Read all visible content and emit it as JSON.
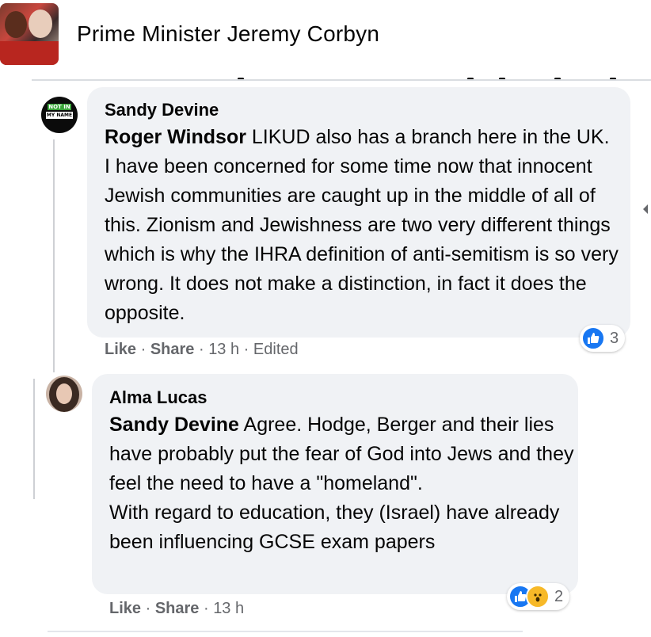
{
  "header": {
    "group_name": "Prime Minister Jeremy Corbyn"
  },
  "comments": [
    {
      "author": "Sandy Devine",
      "avatar_text": [
        "NOT IN",
        "MY NAME"
      ],
      "mention": "Roger Windsor",
      "text": " LIKUD also has a branch here in the UK. I have been concerned for some time now that innocent Jewish communities are caught up in the middle of all of this. Zionism and Jewishness are two very different things which is why the IHRA definition of anti-semitism is so very wrong. It does not make a distinction, in fact it does the opposite.",
      "actions": {
        "like": "Like",
        "share": "Share",
        "sep": " · ",
        "time": "13 h",
        "edited": "Edited"
      },
      "reactions": {
        "icons": [
          "like-icon"
        ],
        "count": "3"
      }
    },
    {
      "author": "Alma Lucas",
      "mention": "Sandy Devine",
      "text_line1": " Agree. Hodge, Berger and their lies have probably put the fear of God into Jews and they feel the need to have a \"homeland\".",
      "text_line2": "With regard to education, they (Israel) have already been influencing GCSE exam papers",
      "actions": {
        "like": "Like",
        "share": "Share",
        "sep": " · ",
        "time": "13 h"
      },
      "reactions": {
        "icons": [
          "like-icon",
          "wow-icon"
        ],
        "count": "2"
      }
    }
  ],
  "colors": {
    "bubble": "#f0f2f5",
    "secondary_text": "#65676b",
    "like_blue": "#1877f2",
    "wow_yellow": "#f7b928"
  }
}
